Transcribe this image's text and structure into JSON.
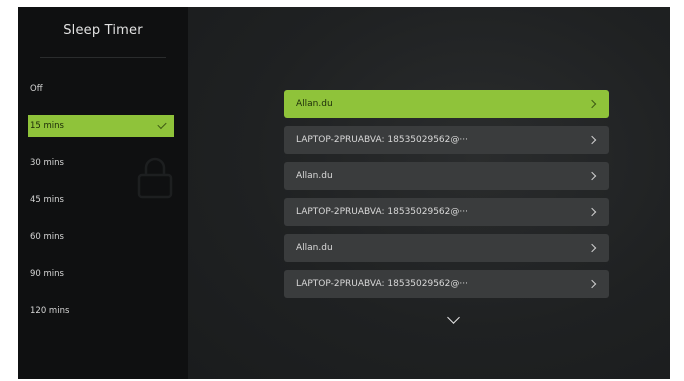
{
  "sidebar": {
    "title": "Sleep Timer",
    "items": [
      {
        "label": "Off"
      },
      {
        "label": "15 mins",
        "selected": true
      },
      {
        "label": "30 mins"
      },
      {
        "label": "45 mins"
      },
      {
        "label": "60 mins"
      },
      {
        "label": "90 mins"
      },
      {
        "label": "120 mins"
      }
    ]
  },
  "devices": {
    "items": [
      {
        "label": "Allan.du",
        "selected": true
      },
      {
        "label": "LAPTOP-2PRUABVA: 18535029562@···"
      },
      {
        "label": "Allan.du"
      },
      {
        "label": "LAPTOP-2PRUABVA: 18535029562@···"
      },
      {
        "label": "Allan.du"
      },
      {
        "label": "LAPTOP-2PRUABVA: 18535029562@···"
      }
    ],
    "more_icon": "chevron-down-icon",
    "item_icon": "chevron-right-icon"
  },
  "colors": {
    "accent": "#8fc33a",
    "sidebar_bg": "#0f1011",
    "main_bg": "#1f2122",
    "row_bg": "#3a3c3d"
  }
}
